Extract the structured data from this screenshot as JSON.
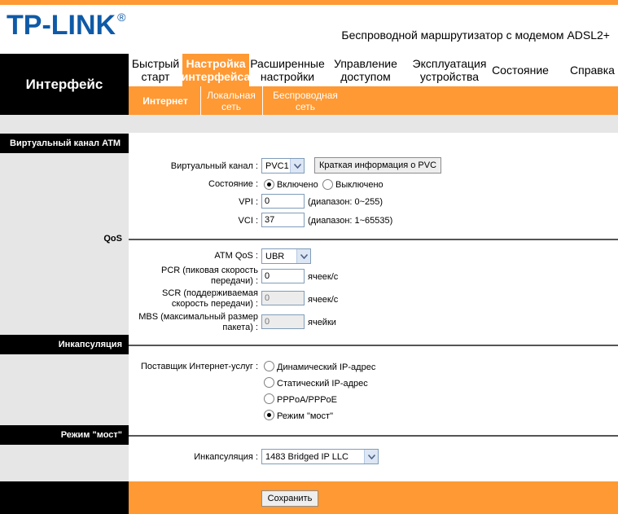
{
  "brand": {
    "logo_text": "TP-LINK",
    "registered": "®",
    "product": "Беспроводной маршрутизатор с модемом ADSL2+"
  },
  "colors": {
    "accent": "#ff9933",
    "logo_blue": "#0e5aa7",
    "black": "#000000",
    "panel_gray": "#e6e6e6"
  },
  "nav": {
    "section_title": "Интерфейс",
    "menu": [
      {
        "label_line1": "Быстрый",
        "label_line2": "старт"
      },
      {
        "label_line1": "Настройка",
        "label_line2": "интерфейса"
      },
      {
        "label_line1": "Расширенные",
        "label_line2": "настройки"
      },
      {
        "label_line1": "Управление",
        "label_line2": "доступом"
      },
      {
        "label_line1": "Эксплуатация",
        "label_line2": "устройства"
      },
      {
        "label_line1": "Состояние",
        "label_line2": ""
      },
      {
        "label_line1": "Справка",
        "label_line2": ""
      }
    ],
    "submenu": [
      {
        "label_line1": "Интернет",
        "label_line2": ""
      },
      {
        "label_line1": "Локальная",
        "label_line2": "сеть"
      },
      {
        "label_line1": "Беспроводная",
        "label_line2": "сеть"
      }
    ]
  },
  "sections": {
    "atm": "Виртуальный канал ATM",
    "qos": "QoS",
    "encap": "Инкапсуляция",
    "bridge": "Режим \"мост\""
  },
  "atm": {
    "vc_label": "Виртуальный канал :",
    "vc_value": "PVC1",
    "pvc_info_button": "Краткая информация о PVC",
    "status_label": "Состояние :",
    "status_on": "Включено",
    "status_off": "Выключено",
    "vpi_label": "VPI :",
    "vpi_value": "0",
    "vpi_range": "(диапазон: 0~255)",
    "vci_label": "VCI :",
    "vci_value": "37",
    "vci_range": "(диапазон: 1~65535)"
  },
  "qos": {
    "atm_qos_label": "ATM QoS :",
    "atm_qos_value": "UBR",
    "pcr_label_1": "PCR (пиковая скорость",
    "pcr_label_2": "передачи) :",
    "pcr_value": "0",
    "pcr_unit": "ячеек/с",
    "scr_label_1": "SCR (поддерживаемая",
    "scr_label_2": "скорость передачи) :",
    "scr_value": "0",
    "scr_unit": "ячеек/с",
    "mbs_label_1": "MBS (максимальный размер",
    "mbs_label_2": "пакета) :",
    "mbs_value": "0",
    "mbs_unit": "ячейки"
  },
  "encap": {
    "isp_label": "Поставщик Интернет-услуг :",
    "options": [
      "Динамический IP-адрес",
      "Статический IP-адрес",
      "PPPoA/PPPoE",
      "Режим \"мост\""
    ]
  },
  "bridge": {
    "encap_label": "Инкапсуляция :",
    "encap_value": "1483 Bridged IP LLC"
  },
  "footer": {
    "save_button": "Сохранить"
  }
}
